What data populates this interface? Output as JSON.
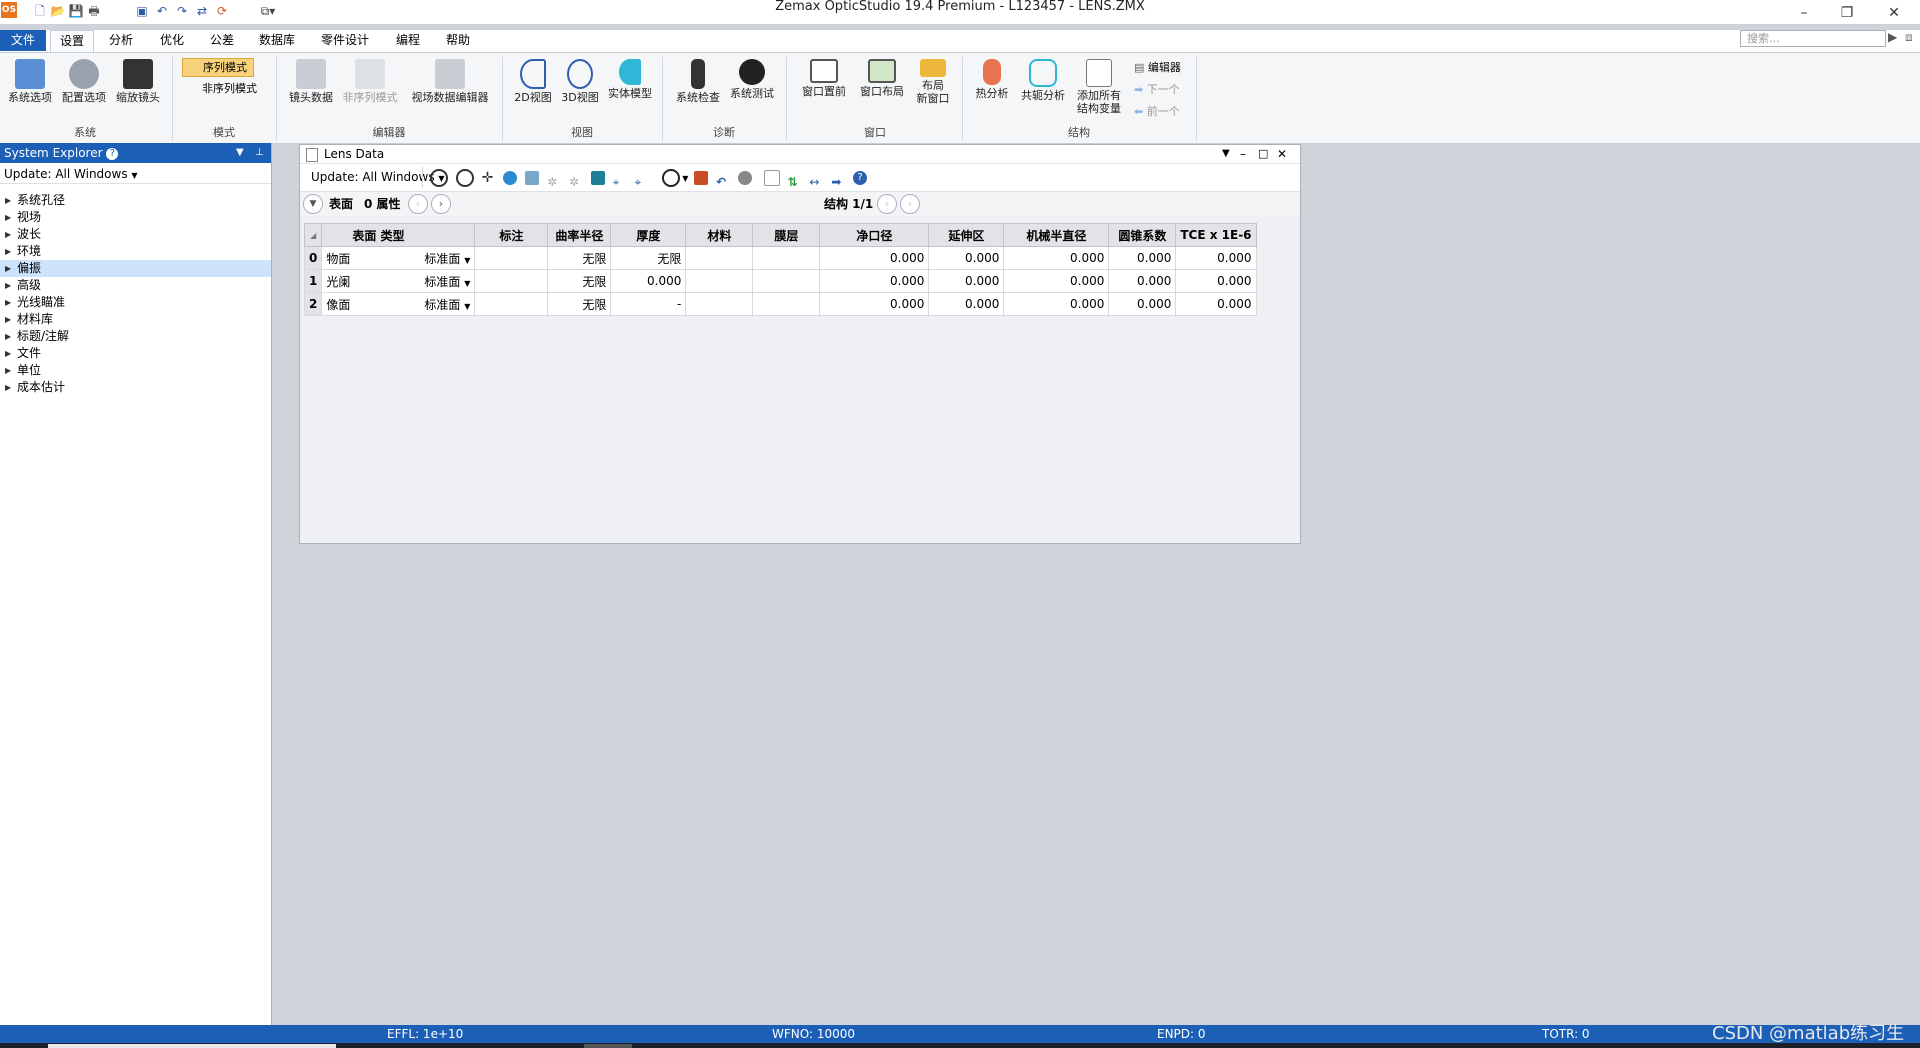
{
  "window": {
    "title": "Zemax OpticStudio 19.4    Premium - L123457 - LENS.ZMX",
    "app_icon": "OS"
  },
  "quick_access": [
    "new-file-icon",
    "open-file-icon",
    "save-icon",
    "print-icon",
    "save-as-icon",
    "undo-icon",
    "redo-icon",
    "refresh-icon",
    "sync-icon",
    "layout-icon"
  ],
  "menu": {
    "items": [
      "文件",
      "设置",
      "分析",
      "优化",
      "公差",
      "数据库",
      "零件设计",
      "编程",
      "帮助"
    ]
  },
  "search": {
    "placeholder": "搜索..."
  },
  "ribbon": {
    "system": {
      "label": "系统",
      "buttons": [
        "系统选项",
        "配置选项",
        "缩放镜头"
      ]
    },
    "mode": {
      "label": "模式",
      "sequential": "序列模式",
      "nonsequential": "非序列模式"
    },
    "editors": {
      "label": "编辑器",
      "buttons": [
        "镜头数据",
        "非序列模式",
        "视场数据编辑器"
      ]
    },
    "view": {
      "label": "视图",
      "buttons": [
        "2D视图",
        "3D视图",
        "实体模型"
      ]
    },
    "diagnostics": {
      "label": "诊断",
      "buttons": [
        "系统检查",
        "系统测试"
      ]
    },
    "window": {
      "label": "窗口",
      "buttons": [
        "窗口置前",
        "窗口布局"
      ],
      "layout_new_line1": "布局",
      "layout_new_line2": "新窗口"
    },
    "config": {
      "label": "结构",
      "buttons": [
        "热分析",
        "共轭分析"
      ],
      "add_all_line1": "添加所有",
      "add_all_line2": "结构变量",
      "editor": "编辑器",
      "next": "下一个",
      "prev": "前一个"
    }
  },
  "explorer": {
    "title": "System Explorer",
    "update": "Update: All Windows",
    "items": [
      "系统孔径",
      "视场",
      "波长",
      "环境",
      "偏振",
      "高级",
      "光线瞄准",
      "材料库",
      "标题/注解",
      "文件",
      "单位",
      "成本估计"
    ],
    "selected_index": 4
  },
  "lens_window": {
    "title": "Lens Data",
    "update": "Update: All Windows",
    "surface_label": "表面",
    "properties_label": "0 属性",
    "config_label": "结构 1/1",
    "columns": [
      "表面 类型",
      "标注",
      "曲率半径",
      "厚度",
      "材料",
      "膜层",
      "净口径",
      "延伸区",
      "机械半直径",
      "圆锥系数",
      "TCE x 1E-6"
    ],
    "rows": [
      {
        "idx": "0",
        "name": "物面",
        "type": "标准面",
        "comment": "",
        "radius": "无限",
        "thickness": "无限",
        "material": "",
        "coating": "",
        "clear": "0.000",
        "chip": "0.000",
        "mech": "0.000",
        "conic": "0.000",
        "tce": "0.000"
      },
      {
        "idx": "1",
        "name": "光阑",
        "type": "标准面",
        "comment": "",
        "radius": "无限",
        "thickness": "0.000",
        "material": "",
        "coating": "",
        "clear": "0.000",
        "chip": "0.000",
        "mech": "0.000",
        "conic": "0.000",
        "tce": "0.000"
      },
      {
        "idx": "2",
        "name": "像面",
        "type": "标准面",
        "comment": "",
        "radius": "无限",
        "thickness": "-",
        "material": "",
        "coating": "",
        "clear": "0.000",
        "chip": "0.000",
        "mech": "0.000",
        "conic": "0.000",
        "tce": "0.000"
      }
    ]
  },
  "status": {
    "effl": "EFFL: 1e+10",
    "wfno": "WFNO: 10000",
    "enpd": "ENPD: 0",
    "totr": "TOTR: 0"
  },
  "watermark": "CSDN @matlab练习生",
  "colors": {
    "accent": "#1c5fb6",
    "selection": "#cde3fb",
    "mode_active": "#f7d27a"
  }
}
